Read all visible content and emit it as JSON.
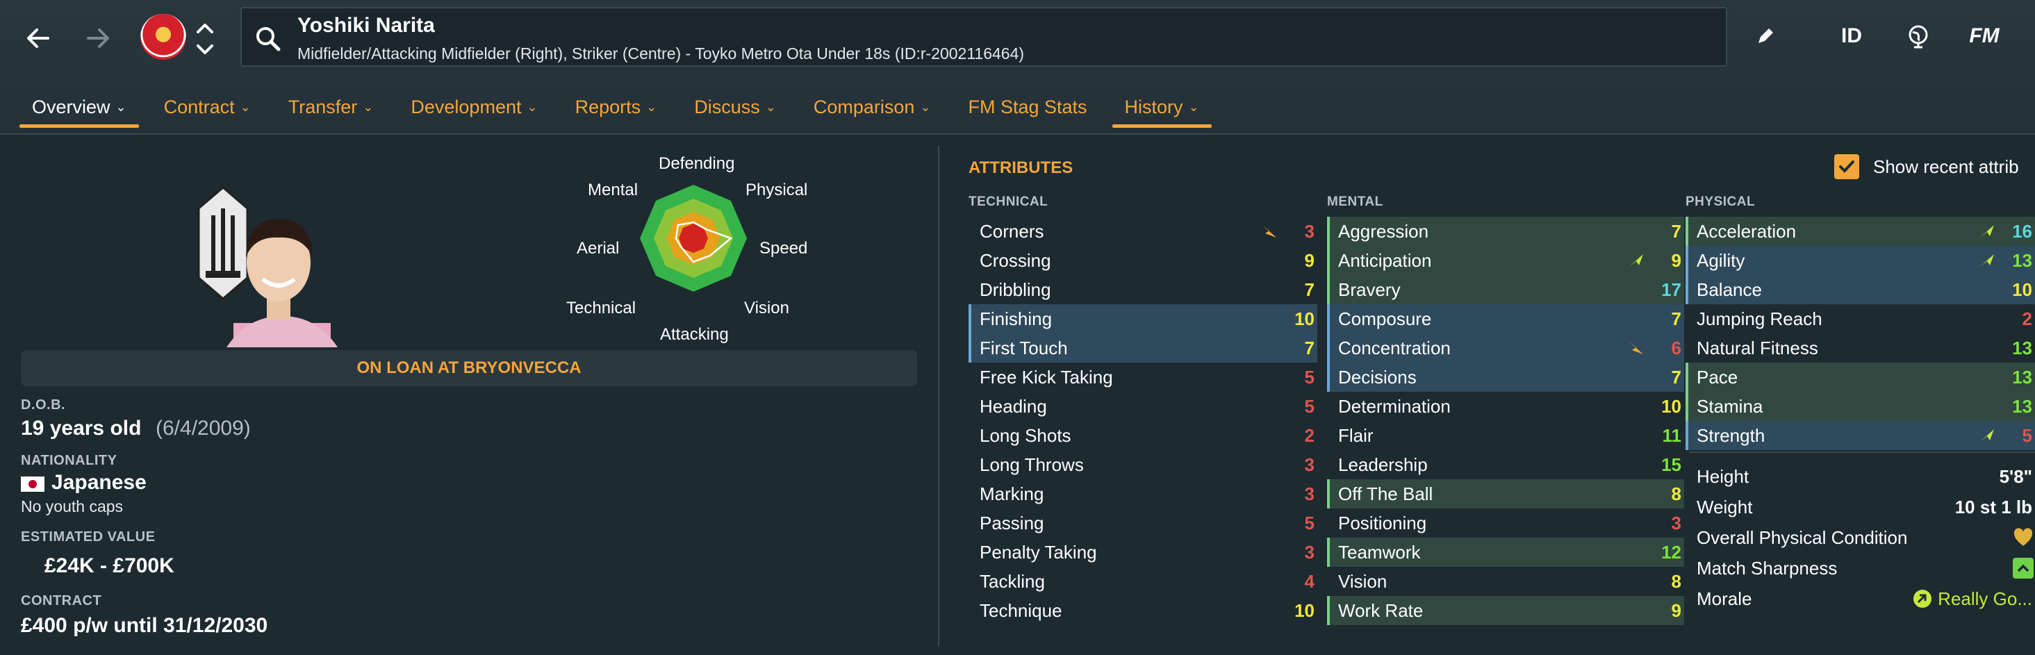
{
  "header": {
    "player_name": "Yoshiki Narita",
    "player_subtitle": "Midfielder/Attacking Midfielder (Right), Striker (Centre) - Toyko Metro Ota Under 18s (ID:r-2002116464)",
    "tool_id_label": "ID",
    "tool_fm_label": "FM"
  },
  "tabs": [
    {
      "label": "Overview",
      "chevron": true
    },
    {
      "label": "Contract",
      "chevron": true
    },
    {
      "label": "Transfer",
      "chevron": true
    },
    {
      "label": "Development",
      "chevron": true
    },
    {
      "label": "Reports",
      "chevron": true
    },
    {
      "label": "Discuss",
      "chevron": true
    },
    {
      "label": "Comparison",
      "chevron": true
    },
    {
      "label": "FM Stag Stats",
      "chevron": false
    },
    {
      "label": "History",
      "chevron": true
    }
  ],
  "profile": {
    "loan_status": "ON LOAN AT BRYONVECCA",
    "dob_label": "D.O.B.",
    "age": "19 years old",
    "dob": "(6/4/2009)",
    "nationality_label": "NATIONALITY",
    "nationality": "Japanese",
    "caps": "No youth caps",
    "value_label": "ESTIMATED VALUE",
    "value": "£24K - £700K",
    "contract_label": "CONTRACT",
    "contract": "£400 p/w until 31/12/2030"
  },
  "radar": {
    "labels": {
      "defending": "Defending",
      "physical": "Physical",
      "speed": "Speed",
      "vision": "Vision",
      "attacking": "Attacking",
      "technical": "Technical",
      "aerial": "Aerial",
      "mental": "Mental"
    }
  },
  "attributes": {
    "title": "ATTRIBUTES",
    "show_recent_label": "Show recent attrib",
    "technical_label": "TECHNICAL",
    "mental_label": "MENTAL",
    "physical_label": "PHYSICAL",
    "technical": [
      {
        "name": "Corners",
        "value": "3",
        "hl": "",
        "trend": "down"
      },
      {
        "name": "Crossing",
        "value": "9",
        "hl": "",
        "trend": ""
      },
      {
        "name": "Dribbling",
        "value": "7",
        "hl": "",
        "trend": ""
      },
      {
        "name": "Finishing",
        "value": "10",
        "hl": "blue",
        "trend": ""
      },
      {
        "name": "First Touch",
        "value": "7",
        "hl": "blue",
        "trend": ""
      },
      {
        "name": "Free Kick Taking",
        "value": "5",
        "hl": "",
        "trend": ""
      },
      {
        "name": "Heading",
        "value": "5",
        "hl": "",
        "trend": ""
      },
      {
        "name": "Long Shots",
        "value": "2",
        "hl": "",
        "trend": ""
      },
      {
        "name": "Long Throws",
        "value": "3",
        "hl": "",
        "trend": ""
      },
      {
        "name": "Marking",
        "value": "3",
        "hl": "",
        "trend": ""
      },
      {
        "name": "Passing",
        "value": "5",
        "hl": "",
        "trend": ""
      },
      {
        "name": "Penalty Taking",
        "value": "3",
        "hl": "",
        "trend": ""
      },
      {
        "name": "Tackling",
        "value": "4",
        "hl": "",
        "trend": ""
      },
      {
        "name": "Technique",
        "value": "10",
        "hl": "",
        "trend": ""
      }
    ],
    "mental": [
      {
        "name": "Aggression",
        "value": "7",
        "hl": "green",
        "trend": ""
      },
      {
        "name": "Anticipation",
        "value": "9",
        "hl": "green",
        "trend": "up"
      },
      {
        "name": "Bravery",
        "value": "17",
        "hl": "green",
        "trend": ""
      },
      {
        "name": "Composure",
        "value": "7",
        "hl": "blue",
        "trend": ""
      },
      {
        "name": "Concentration",
        "value": "6",
        "hl": "blue",
        "trend": "down"
      },
      {
        "name": "Decisions",
        "value": "7",
        "hl": "blue",
        "trend": ""
      },
      {
        "name": "Determination",
        "value": "10",
        "hl": "",
        "trend": ""
      },
      {
        "name": "Flair",
        "value": "11",
        "hl": "",
        "trend": ""
      },
      {
        "name": "Leadership",
        "value": "15",
        "hl": "",
        "trend": ""
      },
      {
        "name": "Off The Ball",
        "value": "8",
        "hl": "green",
        "trend": ""
      },
      {
        "name": "Positioning",
        "value": "3",
        "hl": "",
        "trend": ""
      },
      {
        "name": "Teamwork",
        "value": "12",
        "hl": "green",
        "trend": ""
      },
      {
        "name": "Vision",
        "value": "8",
        "hl": "",
        "trend": ""
      },
      {
        "name": "Work Rate",
        "value": "9",
        "hl": "green",
        "trend": ""
      }
    ],
    "physical": [
      {
        "name": "Acceleration",
        "value": "16",
        "hl": "green",
        "trend": "up"
      },
      {
        "name": "Agility",
        "value": "13",
        "hl": "blue",
        "trend": "up"
      },
      {
        "name": "Balance",
        "value": "10",
        "hl": "blue",
        "trend": ""
      },
      {
        "name": "Jumping Reach",
        "value": "2",
        "hl": "",
        "trend": ""
      },
      {
        "name": "Natural Fitness",
        "value": "13",
        "hl": "",
        "trend": ""
      },
      {
        "name": "Pace",
        "value": "13",
        "hl": "green",
        "trend": ""
      },
      {
        "name": "Stamina",
        "value": "13",
        "hl": "green",
        "trend": ""
      },
      {
        "name": "Strength",
        "value": "5",
        "hl": "blue",
        "trend": "up"
      }
    ],
    "physical_extra": {
      "height_label": "Height",
      "height": "5'8\"",
      "weight_label": "Weight",
      "weight": "10 st 1 lb",
      "condition_label": "Overall Physical Condition",
      "sharpness_label": "Match Sharpness",
      "morale_label": "Morale",
      "morale": "Really Go..."
    }
  },
  "colors": {
    "accent": "#f4a63a",
    "red": "#e0554f",
    "yellow": "#f2e93b",
    "green": "#7ee23a",
    "cyan": "#5bd6e0"
  }
}
